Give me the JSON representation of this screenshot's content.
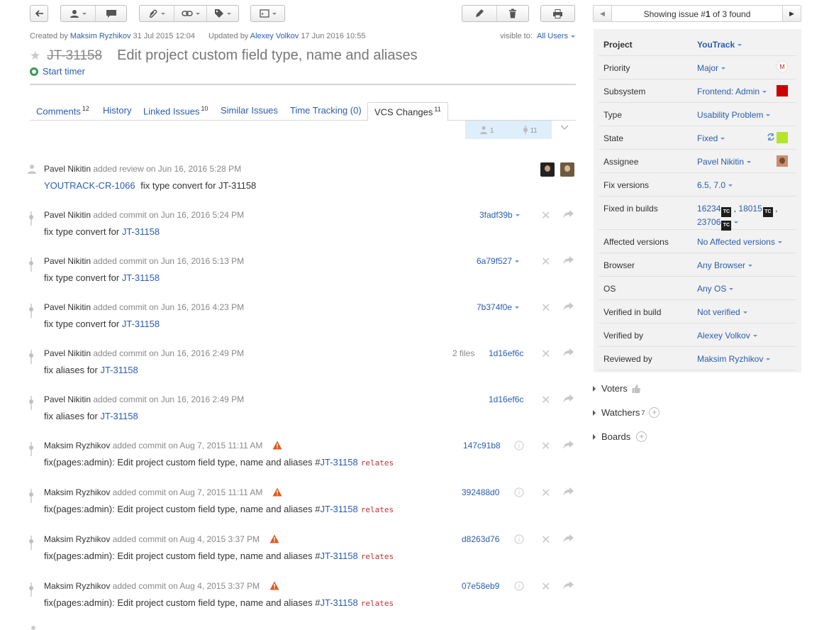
{
  "meta": {
    "created_prefix": "Created by",
    "created_by": "Maksim Ryzhikov",
    "created_date": "31 Jul 2015 12:04",
    "updated_prefix": "Updated by",
    "updated_by": "Alexey Volkov",
    "updated_date": "17 Jun 2016 10:55",
    "visible_label": "visible to:",
    "visible_value": "All Users"
  },
  "issue": {
    "id": "JT-31158",
    "summary": "Edit project custom field type, name and aliases",
    "timer_label": "Start timer"
  },
  "tabs": [
    {
      "label": "Comments",
      "count": "12"
    },
    {
      "label": "History",
      "count": ""
    },
    {
      "label": "Linked Issues",
      "count": "10"
    },
    {
      "label": "Similar Issues",
      "count": ""
    },
    {
      "label": "Time Tracking (0)",
      "count": ""
    },
    {
      "label": "VCS Changes",
      "count": "11"
    }
  ],
  "summary_bar": {
    "reviews": "1",
    "commits": "11"
  },
  "review": {
    "author": "Pavel Nikitin",
    "action": "added review on Jun 16, 2016 5:28 PM",
    "link": "YOUTRACK-CR-1066",
    "text": "fix type convert for JT-31158"
  },
  "commits": [
    {
      "author": "Pavel Nikitin",
      "action": "added commit on Jun 16, 2016 5:24 PM",
      "prefix": "fix type convert for ",
      "issue": "JT-31158",
      "relates": "",
      "hash": "3fadf39b",
      "files": "",
      "warn": false,
      "info": false,
      "dropdown": true
    },
    {
      "author": "Pavel Nikitin",
      "action": "added commit on Jun 16, 2016 5:13 PM",
      "prefix": "fix type convert for ",
      "issue": "JT-31158",
      "relates": "",
      "hash": "6a79f527",
      "files": "",
      "warn": false,
      "info": false,
      "dropdown": true
    },
    {
      "author": "Pavel Nikitin",
      "action": "added commit on Jun 16, 2016 4:23 PM",
      "prefix": "fix type convert for ",
      "issue": "JT-31158",
      "relates": "",
      "hash": "7b374f0e",
      "files": "",
      "warn": false,
      "info": false,
      "dropdown": true
    },
    {
      "author": "Pavel Nikitin",
      "action": "added commit on Jun 16, 2016 2:49 PM",
      "prefix": "fix aliases for ",
      "issue": "JT-31158",
      "relates": "",
      "hash": "1d16ef6c",
      "files": "2 files",
      "warn": false,
      "info": false,
      "dropdown": false
    },
    {
      "author": "Pavel Nikitin",
      "action": "added commit on Jun 16, 2016 2:49 PM",
      "prefix": "fix aliases for ",
      "issue": "JT-31158",
      "relates": "",
      "hash": "1d16ef6c",
      "files": "",
      "warn": false,
      "info": false,
      "dropdown": false
    },
    {
      "author": "Maksim Ryzhikov",
      "action": "added commit on Aug 7, 2015 11:11 AM",
      "prefix": "fix(pages:admin): Edit project custom field type, name and aliases #",
      "issue": "JT-31158",
      "relates": "relates",
      "hash": "147c91b8",
      "files": "",
      "warn": true,
      "info": true,
      "dropdown": false
    },
    {
      "author": "Maksim Ryzhikov",
      "action": "added commit on Aug 7, 2015 11:11 AM",
      "prefix": "fix(pages:admin): Edit project custom field type, name and aliases #",
      "issue": "JT-31158",
      "relates": "relates",
      "hash": "392488d0",
      "files": "",
      "warn": true,
      "info": true,
      "dropdown": false
    },
    {
      "author": "Maksim Ryzhikov",
      "action": "added commit on Aug 4, 2015 3:37 PM",
      "prefix": "fix(pages:admin): Edit project custom field type, name and aliases #",
      "issue": "JT-31158",
      "relates": "relates",
      "hash": "d8263d76",
      "files": "",
      "warn": true,
      "info": true,
      "dropdown": false
    },
    {
      "author": "Maksim Ryzhikov",
      "action": "added commit on Aug 4, 2015 3:37 PM",
      "prefix": "fix(pages:admin): Edit project custom field type, name and aliases #",
      "issue": "JT-31158",
      "relates": "relates",
      "hash": "07e58eb9",
      "files": "",
      "warn": true,
      "info": true,
      "dropdown": false
    }
  ],
  "pager": {
    "prefix": "Showing issue #",
    "num": "1",
    "suffix": " of 3 found"
  },
  "fields": [
    {
      "name": "Project",
      "value": "YouTrack",
      "bold": true
    },
    {
      "name": "Priority",
      "value": "Major",
      "badge": "M"
    },
    {
      "name": "Subsystem",
      "value": "Frontend: Admin",
      "color": "#cc0000"
    },
    {
      "name": "Type",
      "value": "Usability Problem"
    },
    {
      "name": "State",
      "value": "Fixed",
      "color": "#b5e52b"
    },
    {
      "name": "Assignee",
      "value": "Pavel Nikitin"
    },
    {
      "name": "Fix versions",
      "value": "6.5, 7.0"
    },
    {
      "name": "Fixed in builds",
      "builds": [
        "16234",
        "18015",
        "23706"
      ]
    },
    {
      "name": "Affected versions",
      "value": "No Affected versions"
    },
    {
      "name": "Browser",
      "value": "Any Browser"
    },
    {
      "name": "OS",
      "value": "Any OS"
    },
    {
      "name": "Verified in build",
      "value": "Not verified"
    },
    {
      "name": "Verified by",
      "value": "Alexey Volkov"
    },
    {
      "name": "Reviewed by",
      "value": "Maksim Ryzhikov"
    }
  ],
  "tc_label": "TC",
  "sections": {
    "voters": "Voters",
    "watchers": "Watchers",
    "watchers_count": "7",
    "boards": "Boards"
  }
}
